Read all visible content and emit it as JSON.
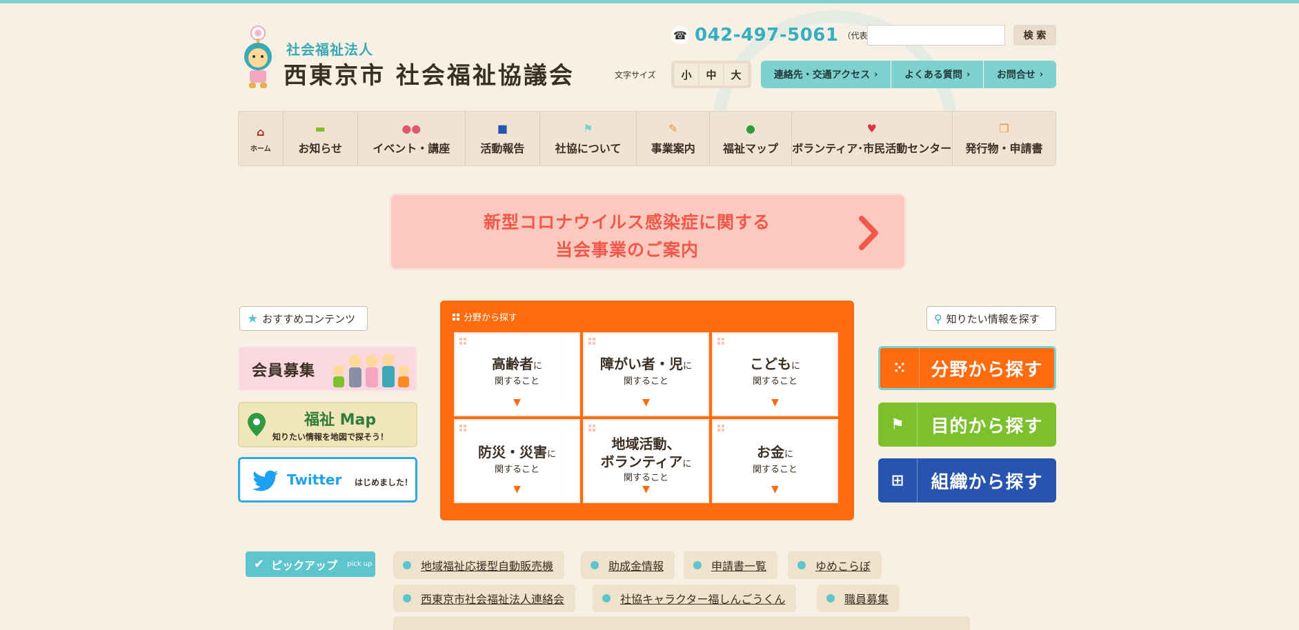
{
  "header": {
    "logo_sub": "社会福祉法人",
    "logo_main": "西東京市 社会福祉協議会",
    "phone": "042-497-5061",
    "phone_note": "（代表）",
    "search_button": "検 索",
    "search_value": "",
    "font_size_label": "文字サイズ",
    "font_sizes": [
      "小",
      "中",
      "大"
    ],
    "util_links": [
      "連絡先・交通アクセス",
      "よくある質問",
      "お問合せ"
    ]
  },
  "nav": {
    "home": "ホーム",
    "items": [
      "お知らせ",
      "イベント・講座",
      "活動報告",
      "社協について",
      "事業案内",
      "福祉マップ",
      "ボランティア･市民活動センター",
      "発行物・申請書"
    ]
  },
  "banner": {
    "line1": "新型コロナウイルス感染症に関する",
    "line2": "当会事業のご案内"
  },
  "left": {
    "recommend": "おすすめコンテンツ",
    "member": "会員募集",
    "map_title": "福祉 Map",
    "map_desc": "知りたい情報を地図で探そう！",
    "twitter": "Twitter",
    "twitter_note": "はじめました！"
  },
  "field": {
    "title": "分野から探す",
    "cells": [
      {
        "main": "高齢者",
        "particle": "に",
        "sub": "関すること"
      },
      {
        "main": "障がい者・児",
        "particle": "に",
        "sub": "関すること"
      },
      {
        "main": "こども",
        "particle": "に",
        "sub": "関すること"
      },
      {
        "main": "防災・災害",
        "particle": "に",
        "sub": "関すること"
      },
      {
        "main1": "地域活動、",
        "main2": "ボランティア",
        "particle": "に",
        "sub": "関すること"
      },
      {
        "main": "お金",
        "particle": "に",
        "sub": "関すること"
      }
    ]
  },
  "right": {
    "info_tag": "知りたい情報を探す",
    "by_field": "分野から探す",
    "by_purpose": "目的から探す",
    "by_org": "組織から探す"
  },
  "pickup": {
    "label": "ピックアップ",
    "label_en": "pick up",
    "links": [
      "地域福祉応援型自動販売機",
      "助成金情報",
      "申請書一覧",
      "ゆめこらぼ",
      "西東京市社会福祉法人連絡会",
      "社協キャラクター福しんごうくん",
      "職員募集"
    ]
  },
  "colors": {
    "accent_teal": "#7fd1cf",
    "field_orange": "#ff6b0f",
    "purpose_green": "#7cc02b",
    "org_blue": "#2654ae",
    "banner_pink": "#fdc9bf"
  }
}
